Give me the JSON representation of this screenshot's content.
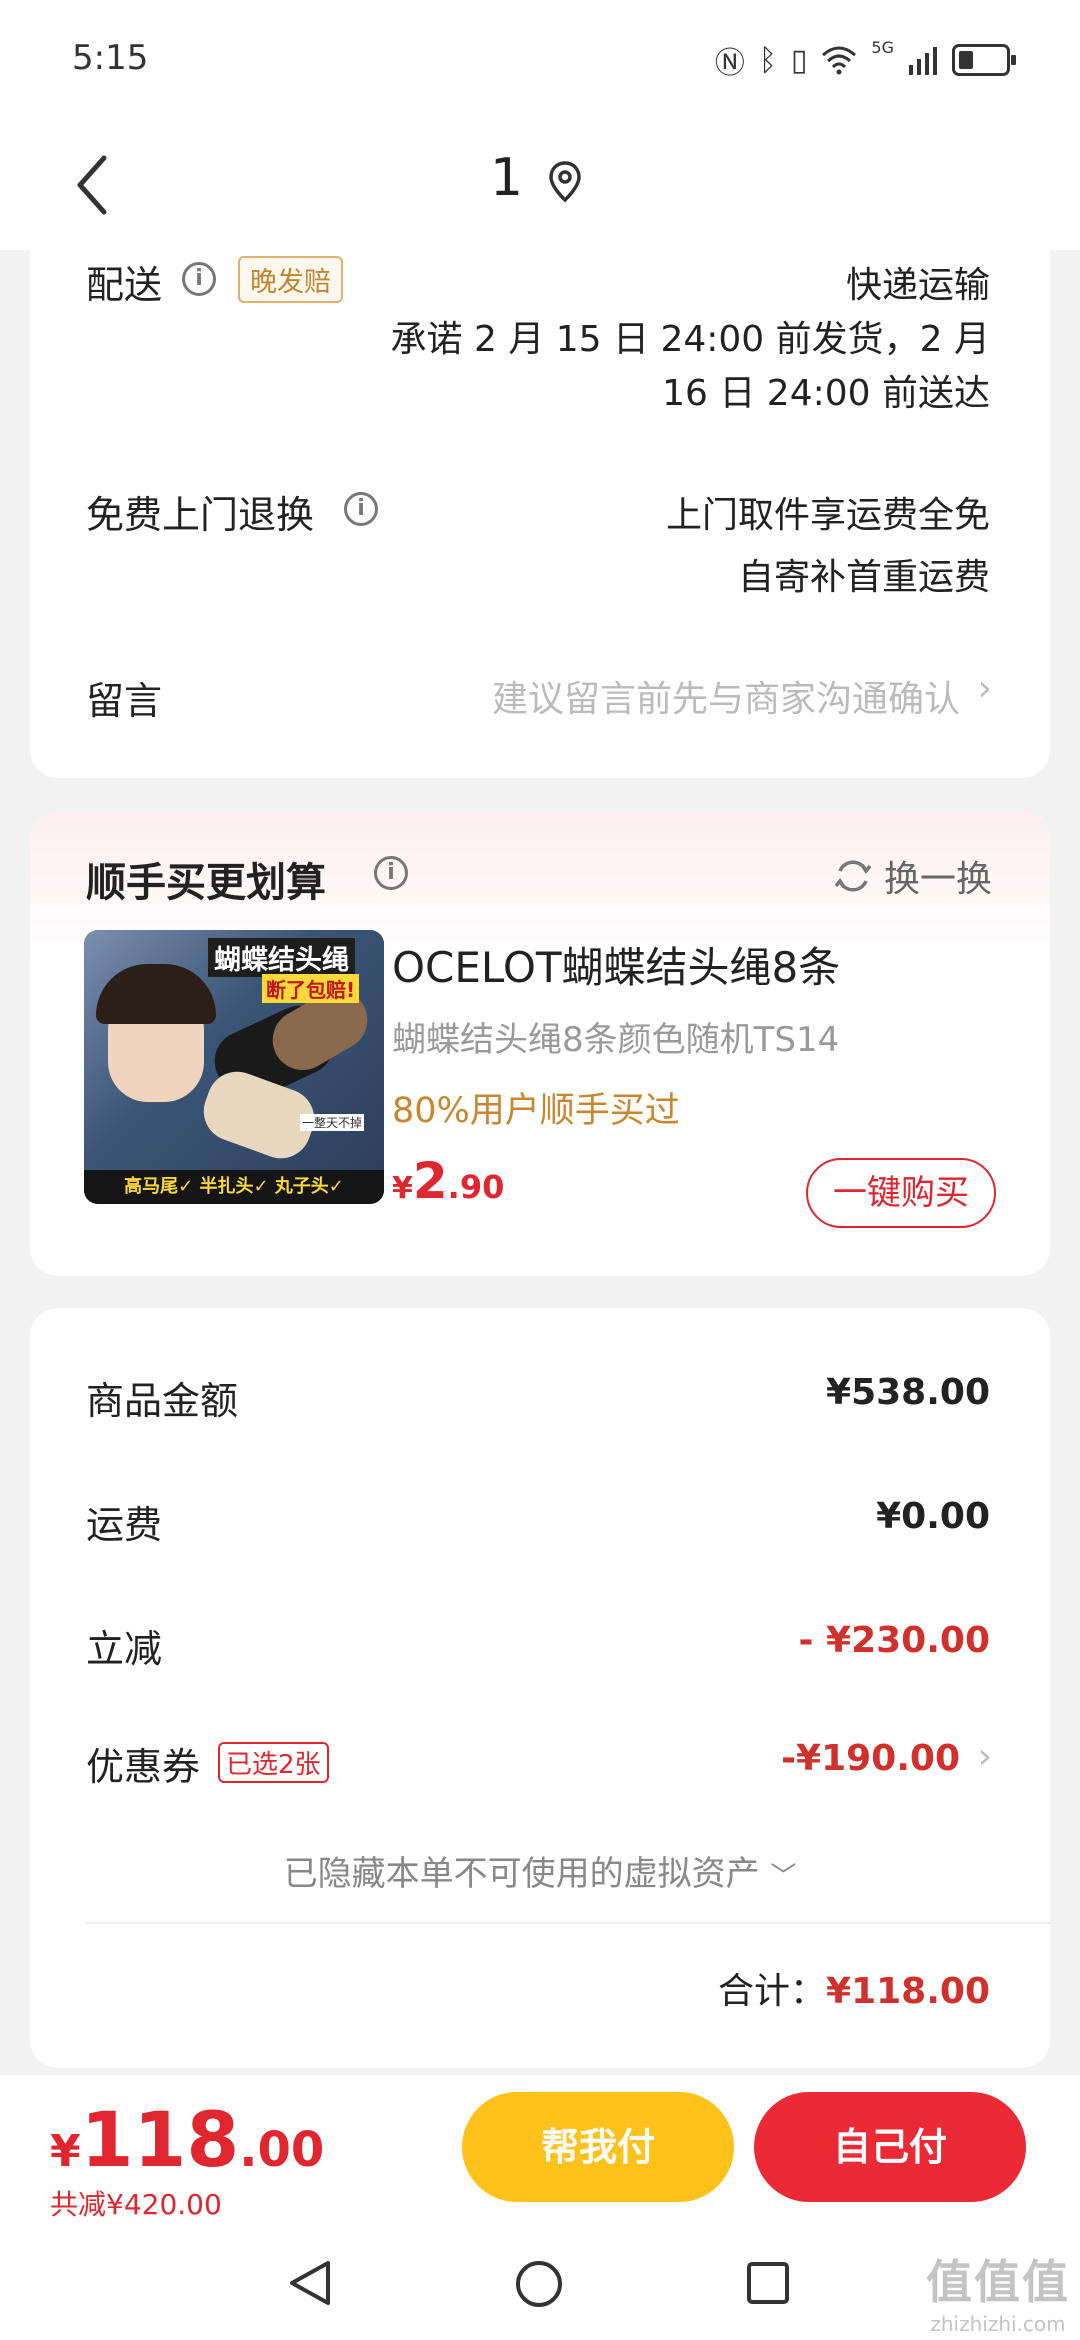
{
  "status_bar": {
    "time": "5:15",
    "network": "5G"
  },
  "nav": {
    "title": "1"
  },
  "delivery": {
    "label": "配送",
    "badge": "晚发赔",
    "method": "快递运输",
    "promise_line1": "承诺 2 月 15 日 24:00 前发货，2 月",
    "promise_line2": "16 日 24:00 前送达"
  },
  "free_return": {
    "label": "免费上门退换",
    "line1": "上门取件享运费全免",
    "line2": "自寄补首重运费"
  },
  "message": {
    "label": "留言",
    "placeholder": "建议留言前先与商家沟通确认"
  },
  "recommend": {
    "title": "顺手买更划算",
    "refresh_label": "换一换",
    "product": {
      "name": "OCELOT蝴蝶结头绳8条",
      "subtitle": "蝴蝶结头绳8条颜色随机TS14",
      "percent": "80%用户顺手买过",
      "currency": "¥",
      "price_int": "2",
      "price_dec": ".90",
      "buy_label": "一键购买",
      "img_title": "蝴蝶结头绳",
      "img_tag": "断了包赔!",
      "img_small": "一整天不掉",
      "img_bottom": "高马尾✓ 半扎头✓ 丸子头✓"
    }
  },
  "summary": {
    "goods_label": "商品金额",
    "goods_value": "¥538.00",
    "shipping_label": "运费",
    "shipping_value": "¥0.00",
    "discount_label": "立减",
    "discount_value": "- ¥230.00",
    "coupon_label": "优惠券",
    "coupon_badge": "已选2张",
    "coupon_value": "-¥190.00",
    "hidden_note": "已隐藏本单不可使用的虚拟资产",
    "total_label": "合计：",
    "total_value": "¥118.00"
  },
  "bottom": {
    "currency": "¥",
    "price_int": "118",
    "price_dec": ".00",
    "saved": "共减¥420.00",
    "help_pay": "帮我付",
    "self_pay": "自己付"
  },
  "watermark": {
    "top": "值值值",
    "bottom": "zhizhizhi.com"
  },
  "colors": {
    "accent_red": "#e0262e",
    "accent_yellow": "#ffc21a",
    "gold": "#c8862e"
  }
}
